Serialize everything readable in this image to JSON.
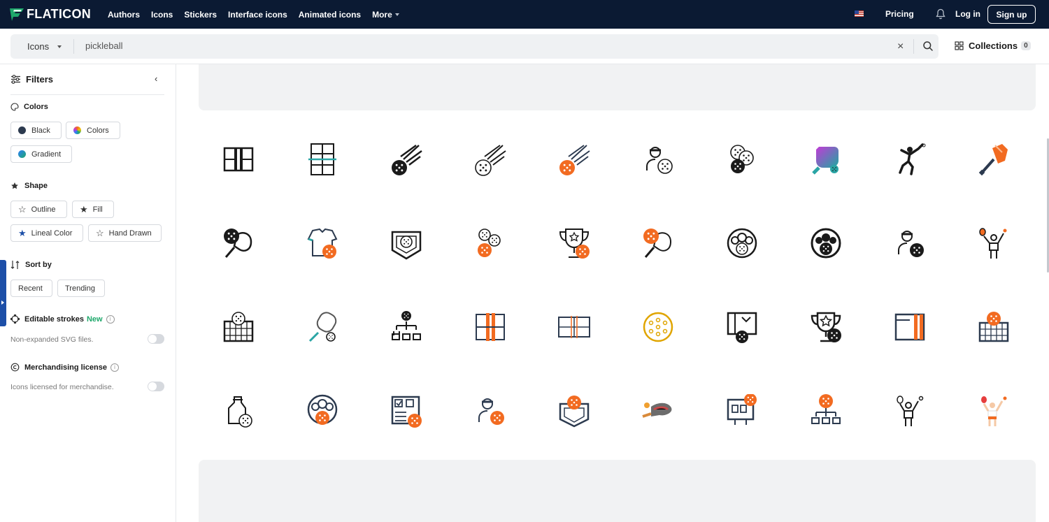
{
  "brand": {
    "name": "FLATICON",
    "accent": "#1ea86b",
    "orange": "#f26b21",
    "navy": "#0b1a33"
  },
  "nav": [
    "Authors",
    "Icons",
    "Stickers",
    "Interface icons",
    "Animated icons",
    "More"
  ],
  "header": {
    "pricing": "Pricing",
    "login": "Log in",
    "signup": "Sign up"
  },
  "search": {
    "type": "Icons",
    "query": "pickleball",
    "clear": "×",
    "collections_label": "Collections",
    "collections_count": "0"
  },
  "sidebar": {
    "title": "Filters",
    "colors": {
      "label": "Colors",
      "options": [
        "Black",
        "Colors",
        "Gradient"
      ]
    },
    "shape": {
      "label": "Shape",
      "options": [
        "Outline",
        "Fill",
        "Lineal Color",
        "Hand Drawn"
      ]
    },
    "sort": {
      "label": "Sort by",
      "options": [
        "Recent",
        "Trending"
      ]
    },
    "strokes": {
      "label": "Editable strokes",
      "badge": "New",
      "desc": "Non-expanded SVG files."
    },
    "merch": {
      "label": "Merchandising license",
      "desc": "Icons licensed for merchandise."
    }
  },
  "icons": [
    "court-net-icon",
    "court-lines-icon",
    "ball-comet-icon",
    "ball-comet-outline-icon",
    "ball-comet-orange-icon",
    "player-ball-icon",
    "balls-stack-icon",
    "paddle-gradient-icon",
    "player-swing-icon",
    "paddle-orange-icon",
    "paddle-ball-icon",
    "jersey-ball-icon",
    "shield-ball-icon",
    "balls-group-icon",
    "trophy-ball-icon",
    "paddle-orange-ball-icon",
    "team-circle-icon",
    "team-circle-dark-icon",
    "coach-ball-icon",
    "player-celebrate-icon",
    "net-ball-icon",
    "paddle-teal-icon",
    "tournament-bracket-icon",
    "court-orange-icon",
    "court-top-view-icon",
    "ball-yellow-icon",
    "scoreboard-ball-icon",
    "trophy-star-ball-icon",
    "court-frame-icon",
    "net-orange-ball-icon",
    "bottle-ball-icon",
    "team-orange-icon",
    "checklist-ball-icon",
    "coach-orange-ball-icon",
    "shield-orange-ball-icon",
    "paddle-sketch-icon",
    "board-ball-icon",
    "bracket-orange-icon",
    "player-outline-icon",
    "player-color-icon"
  ]
}
